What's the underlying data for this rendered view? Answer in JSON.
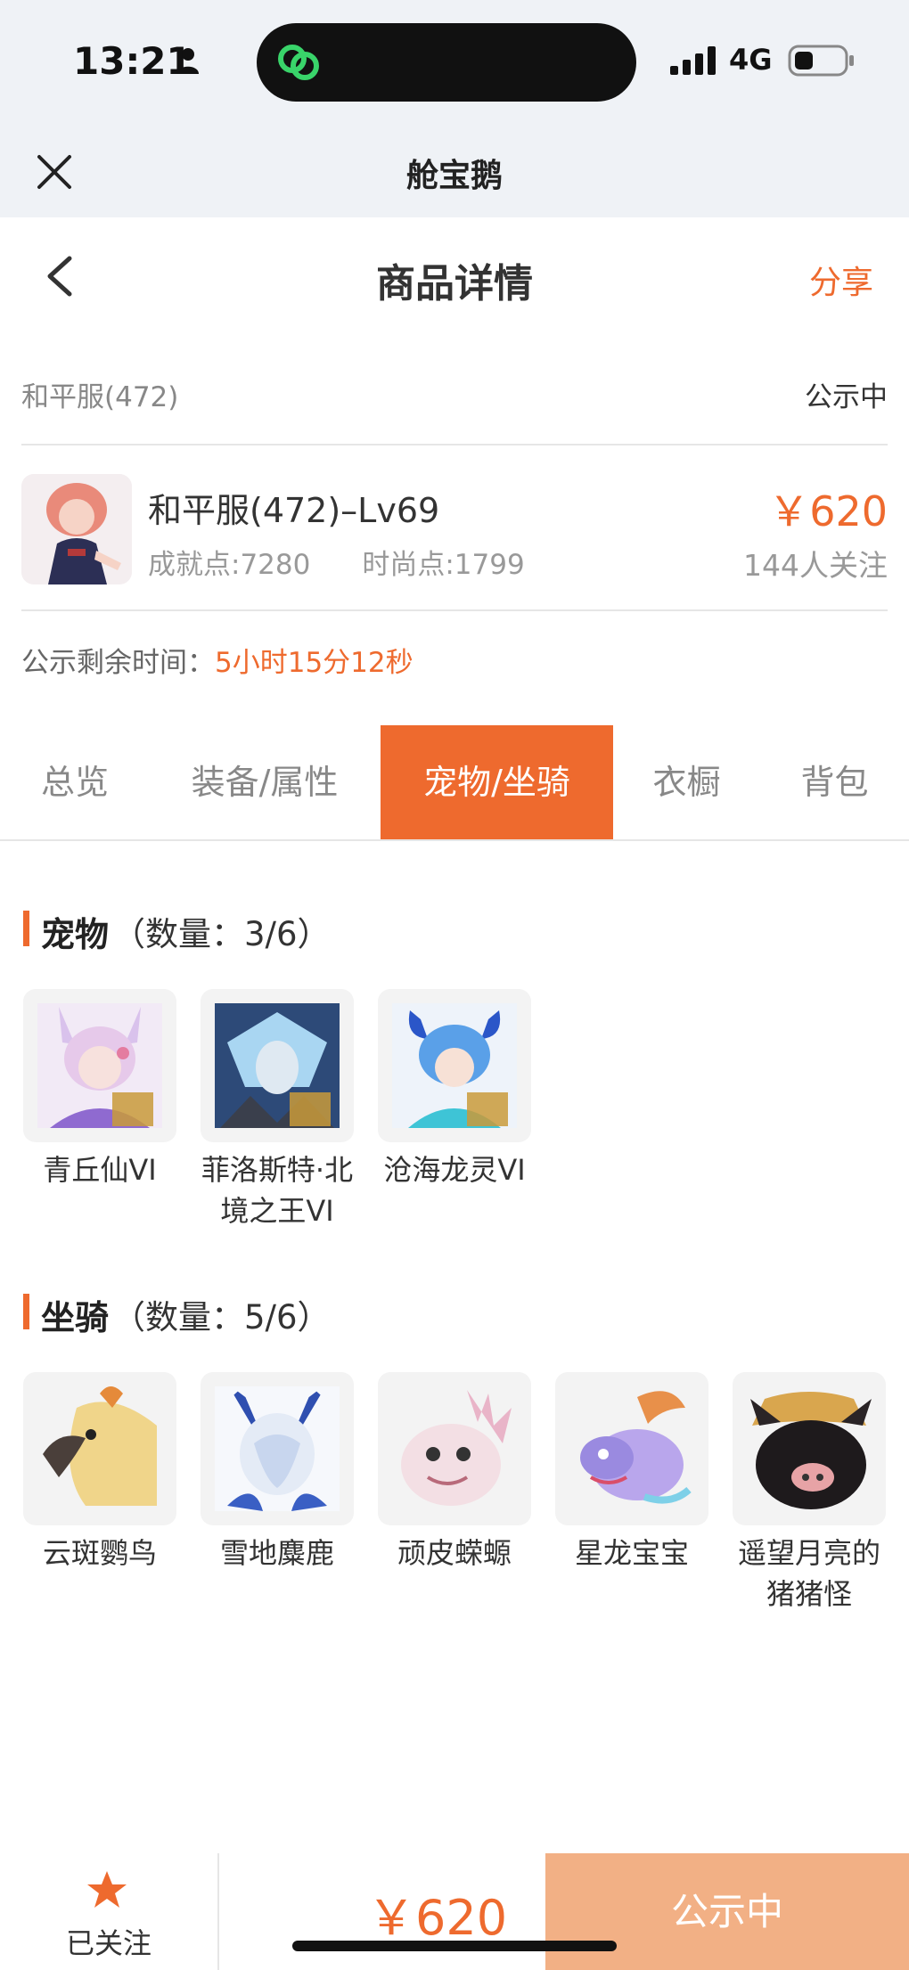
{
  "status_bar": {
    "time": "13:21",
    "network": "4G"
  },
  "app_bar": {
    "title": "舱宝鹅"
  },
  "header": {
    "title": "商品详情",
    "share_label": "分享"
  },
  "listing": {
    "server": "和平服(472)",
    "status": "公示中",
    "title": "和平服(472)–Lv69",
    "achievement": "成就点:7280",
    "fashion": "时尚点:1799",
    "price": "￥620",
    "followers": "144人关注",
    "countdown_label": "公示剩余时间：",
    "countdown_value": "5小时15分12秒"
  },
  "tabs": [
    {
      "label": "总览",
      "active": false
    },
    {
      "label": "装备/属性",
      "active": false
    },
    {
      "label": "宠物/坐骑",
      "active": true
    },
    {
      "label": "衣橱",
      "active": false
    },
    {
      "label": "背包",
      "active": false
    }
  ],
  "pets": {
    "title": "宠物",
    "count": "（数量：3/6）",
    "items": [
      {
        "name": "青丘仙VI",
        "badge": "VI"
      },
      {
        "name": "菲洛斯特·北境之王VI",
        "badge": "VI"
      },
      {
        "name": "沧海龙灵VI",
        "badge": "VI"
      }
    ]
  },
  "mounts": {
    "title": "坐骑",
    "count": "（数量：5/6）",
    "items": [
      {
        "name": "云斑鹦鸟"
      },
      {
        "name": "雪地麋鹿"
      },
      {
        "name": "顽皮蝾螈"
      },
      {
        "name": "星龙宝宝"
      },
      {
        "name": "遥望月亮的猪猪怪"
      }
    ]
  },
  "bottom_bar": {
    "follow_label": "已关注",
    "price": "￥620",
    "cta_label": "公示中"
  },
  "colors": {
    "accent": "#ee6a2e",
    "cta_bg": "#f2b085",
    "page_bg": "#eff2f6"
  },
  "icons": [
    "person-icon",
    "app-logo-icon",
    "signal-icon",
    "battery-icon",
    "close-icon",
    "back-icon",
    "star-icon"
  ]
}
